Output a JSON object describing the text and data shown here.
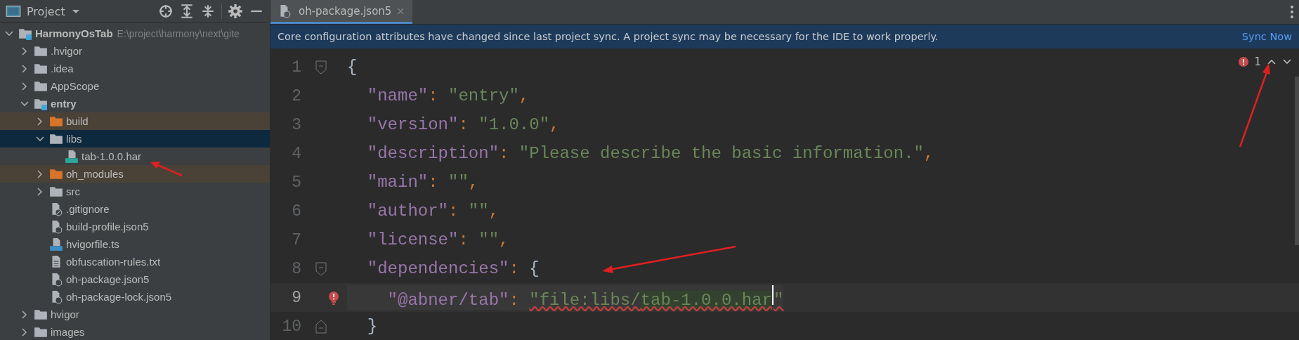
{
  "project_panel": {
    "title": "Project",
    "tree": [
      {
        "name": "HarmonyOsTab",
        "path": "E:\\project\\harmony\\next\\gite",
        "kind": "module",
        "bold": true,
        "expanded": true,
        "selected": false,
        "children": [
          {
            "name": ".hvigor",
            "kind": "folder",
            "bold": false,
            "expanded": false,
            "selected": false
          },
          {
            "name": ".idea",
            "kind": "folder",
            "bold": false,
            "expanded": false,
            "selected": false
          },
          {
            "name": "AppScope",
            "kind": "folder",
            "bold": false,
            "expanded": false,
            "selected": false
          },
          {
            "name": "entry",
            "kind": "module",
            "bold": true,
            "expanded": true,
            "selected": false,
            "children": [
              {
                "name": "build",
                "kind": "excluded",
                "bold": false,
                "expanded": false,
                "selected": false
              },
              {
                "name": "libs",
                "kind": "folder",
                "bold": false,
                "expanded": true,
                "selected": true,
                "children": [
                  {
                    "name": "tab-1.0.0.har",
                    "kind": "har",
                    "bold": false,
                    "selected": false
                  }
                ]
              },
              {
                "name": "oh_modules",
                "kind": "excluded",
                "bold": false,
                "expanded": false,
                "selected": false
              },
              {
                "name": "src",
                "kind": "folder",
                "bold": false,
                "expanded": false,
                "selected": false
              },
              {
                "name": ".gitignore",
                "kind": "ignore",
                "bold": false,
                "selected": false
              },
              {
                "name": "build-profile.json5",
                "kind": "json",
                "bold": false,
                "selected": false
              },
              {
                "name": "hvigorfile.ts",
                "kind": "ts",
                "bold": false,
                "selected": false
              },
              {
                "name": "obfuscation-rules.txt",
                "kind": "text",
                "bold": false,
                "selected": false
              },
              {
                "name": "oh-package.json5",
                "kind": "json",
                "bold": false,
                "selected": false
              },
              {
                "name": "oh-package-lock.json5",
                "kind": "json",
                "bold": false,
                "selected": false
              }
            ]
          },
          {
            "name": "hvigor",
            "kind": "folder",
            "bold": false,
            "expanded": false,
            "selected": false
          },
          {
            "name": "images",
            "kind": "folder",
            "bold": false,
            "expanded": false,
            "selected": false
          }
        ]
      }
    ]
  },
  "editor": {
    "tabs": [
      {
        "label": "oh-package.json5",
        "close": "×",
        "selected": true
      }
    ],
    "banner": {
      "message": "Core configuration attributes have changed since last project sync. A project sync may be necessary for the IDE to work properly.",
      "action": "Sync Now"
    },
    "problems": {
      "count": "1"
    },
    "lines": [
      {
        "number": "1",
        "kind": "fold-start",
        "current": false,
        "error": false,
        "tokens": [
          {
            "kind": "brace",
            "text": "{"
          }
        ]
      },
      {
        "number": "2",
        "kind": "plain",
        "current": false,
        "error": false,
        "tokens": [
          {
            "kind": "key",
            "text": "  \"name\""
          },
          {
            "kind": "punct",
            "text": ": "
          },
          {
            "kind": "string",
            "text": "\"entry\""
          },
          {
            "kind": "punct",
            "text": ","
          }
        ]
      },
      {
        "number": "3",
        "kind": "plain",
        "current": false,
        "error": false,
        "tokens": [
          {
            "kind": "key",
            "text": "  \"version\""
          },
          {
            "kind": "punct",
            "text": ": "
          },
          {
            "kind": "string",
            "text": "\"1.0.0\""
          },
          {
            "kind": "punct",
            "text": ","
          }
        ]
      },
      {
        "number": "4",
        "kind": "plain",
        "current": false,
        "error": false,
        "tokens": [
          {
            "kind": "key",
            "text": "  \"description\""
          },
          {
            "kind": "punct",
            "text": ": "
          },
          {
            "kind": "string",
            "text": "\"Please describe the basic information.\""
          },
          {
            "kind": "punct",
            "text": ","
          }
        ]
      },
      {
        "number": "5",
        "kind": "plain",
        "current": false,
        "error": false,
        "tokens": [
          {
            "kind": "key",
            "text": "  \"main\""
          },
          {
            "kind": "punct",
            "text": ": "
          },
          {
            "kind": "string",
            "text": "\"\""
          },
          {
            "kind": "punct",
            "text": ","
          }
        ]
      },
      {
        "number": "6",
        "kind": "plain",
        "current": false,
        "error": false,
        "tokens": [
          {
            "kind": "key",
            "text": "  \"author\""
          },
          {
            "kind": "punct",
            "text": ": "
          },
          {
            "kind": "string",
            "text": "\"\""
          },
          {
            "kind": "punct",
            "text": ","
          }
        ]
      },
      {
        "number": "7",
        "kind": "plain",
        "current": false,
        "error": false,
        "tokens": [
          {
            "kind": "key",
            "text": "  \"license\""
          },
          {
            "kind": "punct",
            "text": ": "
          },
          {
            "kind": "string",
            "text": "\"\""
          },
          {
            "kind": "punct",
            "text": ","
          }
        ]
      },
      {
        "number": "8",
        "kind": "fold-start",
        "current": false,
        "error": false,
        "tokens": [
          {
            "kind": "key",
            "text": "  \"dependencies\""
          },
          {
            "kind": "punct",
            "text": ": "
          },
          {
            "kind": "brace",
            "text": "{"
          }
        ]
      },
      {
        "number": "9",
        "kind": "plain",
        "current": true,
        "error": true,
        "tokens": [
          {
            "kind": "key",
            "text": "    \"@abner/tab\""
          },
          {
            "kind": "punct",
            "text": ": "
          },
          {
            "kind": "string",
            "text": "\"file:libs/"
          },
          {
            "kind": "match",
            "text": "tab-1.0.0.har"
          },
          {
            "kind": "caret"
          },
          {
            "kind": "string",
            "text": "\""
          }
        ]
      },
      {
        "number": "10",
        "kind": "fold-end",
        "current": false,
        "error": false,
        "tokens": [
          {
            "kind": "brace",
            "text": "  }"
          }
        ]
      }
    ]
  }
}
